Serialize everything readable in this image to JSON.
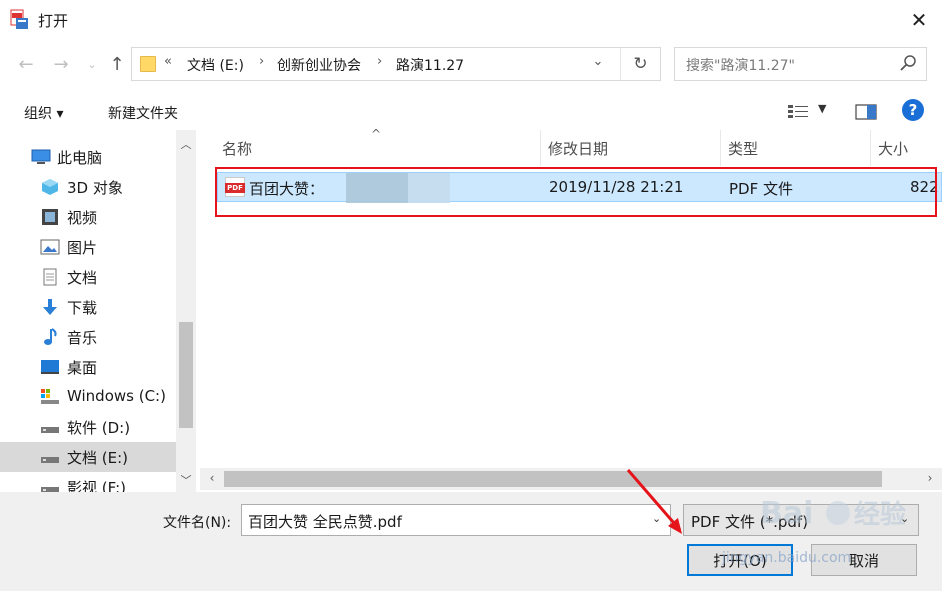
{
  "window": {
    "title": "打开",
    "close_glyph": "✕"
  },
  "address": {
    "overflow": "«",
    "breadcrumbs": [
      "文档 (E:)",
      "创新创业协会",
      "路演11.27"
    ],
    "separator": "›"
  },
  "search": {
    "placeholder": "搜索\"路演11.27\""
  },
  "toolbar": {
    "organize": "组织 ▾",
    "new_folder": "新建文件夹",
    "help": "?"
  },
  "sidebar": {
    "items": [
      {
        "label": "此电脑",
        "icon": "computer-icon"
      },
      {
        "label": "3D 对象",
        "icon": "3d-objects-icon"
      },
      {
        "label": "视频",
        "icon": "video-icon"
      },
      {
        "label": "图片",
        "icon": "pictures-icon"
      },
      {
        "label": "文档",
        "icon": "documents-icon"
      },
      {
        "label": "下载",
        "icon": "download-icon"
      },
      {
        "label": "音乐",
        "icon": "music-icon"
      },
      {
        "label": "桌面",
        "icon": "desktop-icon"
      },
      {
        "label": "Windows (C:)",
        "icon": "drive-c-icon"
      },
      {
        "label": "软件 (D:)",
        "icon": "drive-d-icon"
      },
      {
        "label": "文档 (E:)",
        "icon": "drive-e-icon",
        "selected": true
      },
      {
        "label": "影视 (F:)",
        "icon": "drive-f-icon"
      }
    ]
  },
  "columns": {
    "name": "名称",
    "modified": "修改日期",
    "type": "类型",
    "size": "大小"
  },
  "files": [
    {
      "name": "百团大赞：",
      "modified": "2019/11/28 21:21",
      "type": "PDF 文件",
      "size": "822",
      "icon_text": "PDF"
    }
  ],
  "footer": {
    "filename_label": "文件名(N):",
    "filename_value": "百团大赞 全民点赞.pdf",
    "filetype_value": "PDF 文件 (*.pdf)",
    "open_label": "打开(O)",
    "cancel_label": "取消"
  },
  "watermark": {
    "text": "jingyan.baidu.com",
    "brand": "Baidu 经验"
  },
  "colors": {
    "selection": "#cce8ff",
    "highlight_border": "#e5141b",
    "accent": "#0078d7"
  }
}
